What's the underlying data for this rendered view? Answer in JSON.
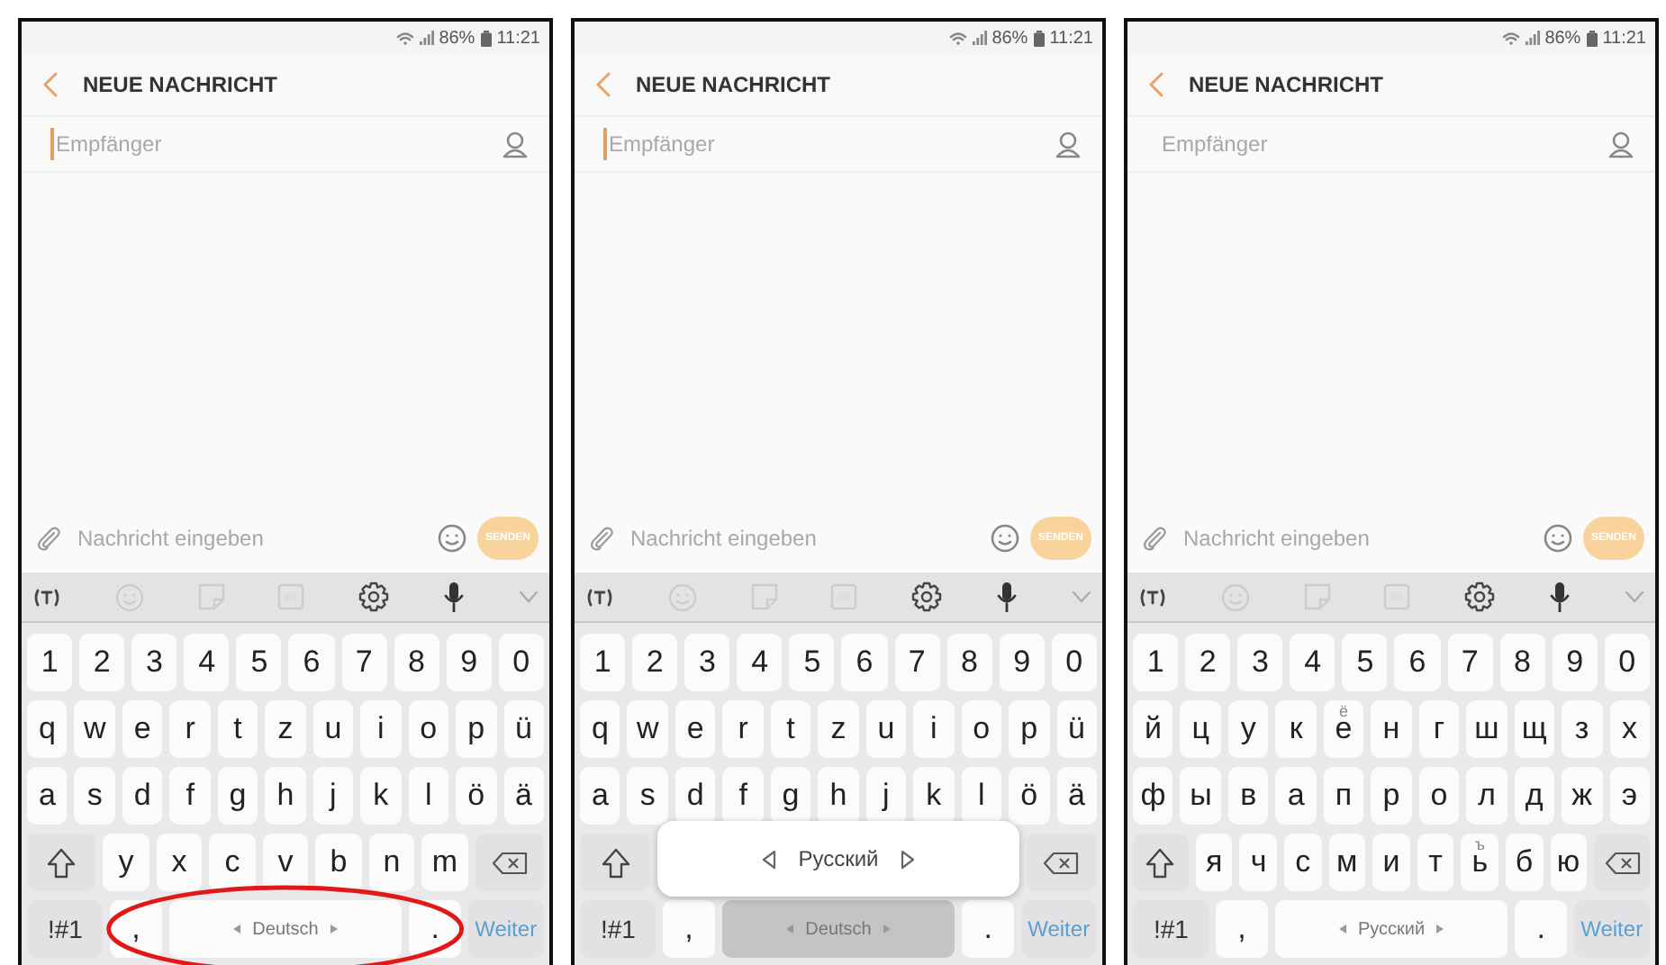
{
  "phones": [
    {
      "status_bar": {
        "battery": "86%",
        "time": "11:21"
      },
      "header": {
        "title": "NEUE NACHRICHT"
      },
      "recipient": {
        "placeholder": "Empfänger",
        "focused": true
      },
      "composer": {
        "placeholder": "Nachricht eingeben",
        "send": {
          "label": "SENDEN",
          "disabled": true
        }
      },
      "circled": true,
      "keyboard": {
        "rows": [
          {
            "keys": [
              {
                "kind": "char",
                "label": "1"
              },
              {
                "kind": "char",
                "label": "2"
              },
              {
                "kind": "char",
                "label": "3"
              },
              {
                "kind": "char",
                "label": "4"
              },
              {
                "kind": "char",
                "label": "5"
              },
              {
                "kind": "char",
                "label": "6"
              },
              {
                "kind": "char",
                "label": "7"
              },
              {
                "kind": "char",
                "label": "8"
              },
              {
                "kind": "char",
                "label": "9"
              },
              {
                "kind": "char",
                "label": "0"
              }
            ]
          },
          {
            "keys": [
              {
                "kind": "char",
                "label": "q"
              },
              {
                "kind": "char",
                "label": "w"
              },
              {
                "kind": "char",
                "label": "e"
              },
              {
                "kind": "char",
                "label": "r"
              },
              {
                "kind": "char",
                "label": "t"
              },
              {
                "kind": "char",
                "label": "z"
              },
              {
                "kind": "char",
                "label": "u"
              },
              {
                "kind": "char",
                "label": "i"
              },
              {
                "kind": "char",
                "label": "o"
              },
              {
                "kind": "char",
                "label": "p"
              },
              {
                "kind": "char",
                "label": "ü"
              }
            ]
          },
          {
            "keys": [
              {
                "kind": "char",
                "label": "a"
              },
              {
                "kind": "char",
                "label": "s"
              },
              {
                "kind": "char",
                "label": "d"
              },
              {
                "kind": "char",
                "label": "f"
              },
              {
                "kind": "char",
                "label": "g"
              },
              {
                "kind": "char",
                "label": "h"
              },
              {
                "kind": "char",
                "label": "j"
              },
              {
                "kind": "char",
                "label": "k"
              },
              {
                "kind": "char",
                "label": "l"
              },
              {
                "kind": "char",
                "label": "ö"
              },
              {
                "kind": "char",
                "label": "ä"
              }
            ]
          },
          {
            "keys": [
              {
                "kind": "shift"
              },
              {
                "kind": "char",
                "label": "y"
              },
              {
                "kind": "char",
                "label": "x"
              },
              {
                "kind": "char",
                "label": "c"
              },
              {
                "kind": "char",
                "label": "v"
              },
              {
                "kind": "char",
                "label": "b"
              },
              {
                "kind": "char",
                "label": "n"
              },
              {
                "kind": "char",
                "label": "m"
              },
              {
                "kind": "backspace"
              }
            ]
          },
          {
            "keys": [
              {
                "kind": "symbols",
                "label": "!#1"
              },
              {
                "kind": "char",
                "label": ","
              },
              {
                "kind": "space",
                "label": "Deutsch",
                "pressed": false
              },
              {
                "kind": "char",
                "label": "."
              },
              {
                "kind": "action",
                "label": "Weiter"
              }
            ]
          }
        ]
      }
    },
    {
      "status_bar": {
        "battery": "86%",
        "time": "11:21"
      },
      "header": {
        "title": "NEUE NACHRICHT"
      },
      "recipient": {
        "placeholder": "Empfänger",
        "focused": true
      },
      "composer": {
        "placeholder": "Nachricht eingeben",
        "send": {
          "label": "SENDEN",
          "disabled": true
        }
      },
      "circled": false,
      "keyboard": {
        "rows": [
          {
            "keys": [
              {
                "kind": "char",
                "label": "1"
              },
              {
                "kind": "char",
                "label": "2"
              },
              {
                "kind": "char",
                "label": "3"
              },
              {
                "kind": "char",
                "label": "4"
              },
              {
                "kind": "char",
                "label": "5"
              },
              {
                "kind": "char",
                "label": "6"
              },
              {
                "kind": "char",
                "label": "7"
              },
              {
                "kind": "char",
                "label": "8"
              },
              {
                "kind": "char",
                "label": "9"
              },
              {
                "kind": "char",
                "label": "0"
              }
            ]
          },
          {
            "keys": [
              {
                "kind": "char",
                "label": "q"
              },
              {
                "kind": "char",
                "label": "w"
              },
              {
                "kind": "char",
                "label": "e"
              },
              {
                "kind": "char",
                "label": "r"
              },
              {
                "kind": "char",
                "label": "t"
              },
              {
                "kind": "char",
                "label": "z"
              },
              {
                "kind": "char",
                "label": "u"
              },
              {
                "kind": "char",
                "label": "i"
              },
              {
                "kind": "char",
                "label": "o"
              },
              {
                "kind": "char",
                "label": "p"
              },
              {
                "kind": "char",
                "label": "ü"
              }
            ]
          },
          {
            "keys": [
              {
                "kind": "char",
                "label": "a"
              },
              {
                "kind": "char",
                "label": "s"
              },
              {
                "kind": "char",
                "label": "d"
              },
              {
                "kind": "char",
                "label": "f"
              },
              {
                "kind": "char",
                "label": "g"
              },
              {
                "kind": "char",
                "label": "h"
              },
              {
                "kind": "char",
                "label": "j"
              },
              {
                "kind": "char",
                "label": "k"
              },
              {
                "kind": "char",
                "label": "l"
              },
              {
                "kind": "char",
                "label": "ö"
              },
              {
                "kind": "char",
                "label": "ä"
              }
            ]
          },
          {
            "keys": [
              {
                "kind": "shift"
              },
              {
                "kind": "popup",
                "label": "Русский"
              },
              {
                "kind": "backspace"
              }
            ]
          },
          {
            "keys": [
              {
                "kind": "symbols",
                "label": "!#1"
              },
              {
                "kind": "char",
                "label": ","
              },
              {
                "kind": "space",
                "label": "Deutsch",
                "pressed": true
              },
              {
                "kind": "char",
                "label": "."
              },
              {
                "kind": "action",
                "label": "Weiter"
              }
            ]
          }
        ]
      }
    },
    {
      "status_bar": {
        "battery": "86%",
        "time": "11:21"
      },
      "header": {
        "title": "NEUE NACHRICHT"
      },
      "recipient": {
        "placeholder": "Empfänger",
        "focused": false
      },
      "composer": {
        "placeholder": "Nachricht eingeben",
        "send": {
          "label": "SENDEN",
          "disabled": true
        }
      },
      "circled": false,
      "keyboard": {
        "rows": [
          {
            "keys": [
              {
                "kind": "char",
                "label": "1"
              },
              {
                "kind": "char",
                "label": "2"
              },
              {
                "kind": "char",
                "label": "3"
              },
              {
                "kind": "char",
                "label": "4"
              },
              {
                "kind": "char",
                "label": "5"
              },
              {
                "kind": "char",
                "label": "6"
              },
              {
                "kind": "char",
                "label": "7"
              },
              {
                "kind": "char",
                "label": "8"
              },
              {
                "kind": "char",
                "label": "9"
              },
              {
                "kind": "char",
                "label": "0"
              }
            ]
          },
          {
            "keys": [
              {
                "kind": "char",
                "label": "й"
              },
              {
                "kind": "char",
                "label": "ц"
              },
              {
                "kind": "char",
                "label": "у"
              },
              {
                "kind": "char",
                "label": "к"
              },
              {
                "kind": "char",
                "label": "е",
                "hint": "ё"
              },
              {
                "kind": "char",
                "label": "н"
              },
              {
                "kind": "char",
                "label": "г"
              },
              {
                "kind": "char",
                "label": "ш"
              },
              {
                "kind": "char",
                "label": "щ"
              },
              {
                "kind": "char",
                "label": "з"
              },
              {
                "kind": "char",
                "label": "х"
              }
            ]
          },
          {
            "keys": [
              {
                "kind": "char",
                "label": "ф"
              },
              {
                "kind": "char",
                "label": "ы"
              },
              {
                "kind": "char",
                "label": "в"
              },
              {
                "kind": "char",
                "label": "а"
              },
              {
                "kind": "char",
                "label": "п"
              },
              {
                "kind": "char",
                "label": "р"
              },
              {
                "kind": "char",
                "label": "о"
              },
              {
                "kind": "char",
                "label": "л"
              },
              {
                "kind": "char",
                "label": "д"
              },
              {
                "kind": "char",
                "label": "ж"
              },
              {
                "kind": "char",
                "label": "э"
              }
            ]
          },
          {
            "keys": [
              {
                "kind": "shift"
              },
              {
                "kind": "char",
                "label": "я"
              },
              {
                "kind": "char",
                "label": "ч"
              },
              {
                "kind": "char",
                "label": "с"
              },
              {
                "kind": "char",
                "label": "м"
              },
              {
                "kind": "char",
                "label": "и"
              },
              {
                "kind": "char",
                "label": "т"
              },
              {
                "kind": "char",
                "label": "ь",
                "hint": "ъ"
              },
              {
                "kind": "char",
                "label": "б"
              },
              {
                "kind": "char",
                "label": "ю"
              },
              {
                "kind": "backspace"
              }
            ]
          },
          {
            "keys": [
              {
                "kind": "symbols",
                "label": "!#1"
              },
              {
                "kind": "char",
                "label": ","
              },
              {
                "kind": "space",
                "label": "Русский",
                "pressed": false
              },
              {
                "kind": "char",
                "label": "."
              },
              {
                "kind": "action",
                "label": "Weiter"
              }
            ]
          }
        ]
      }
    }
  ]
}
